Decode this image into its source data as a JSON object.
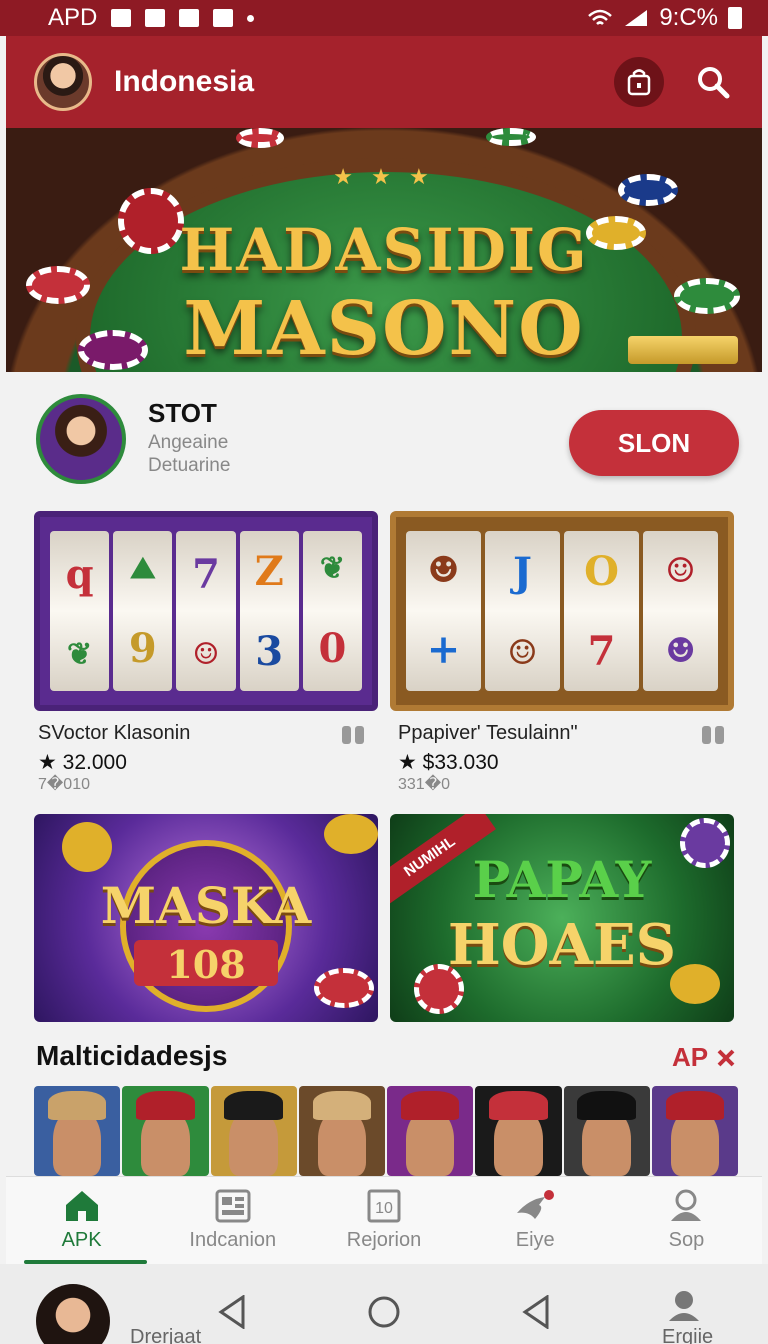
{
  "status_bar": {
    "left_text": "APD",
    "right_text": "9:C%"
  },
  "app_bar": {
    "title": "Indonesia",
    "icons": [
      "profile-avatar",
      "bag-icon",
      "search-icon"
    ]
  },
  "hero": {
    "line1": "HADASIDIG",
    "line2": "MASONO",
    "stars": "★ ★ ★"
  },
  "featured": {
    "name": "STOT",
    "subtitle1": "Angeaine",
    "subtitle2": "Detuarine",
    "button_label": "SLON"
  },
  "slot_cards": [
    {
      "title": "SVoctor Klasonin",
      "price": "32.000",
      "meta": "7�010",
      "reels": [
        "q",
        "7",
        "Z",
        "9",
        "3"
      ]
    },
    {
      "title": "Ppapiver' Tesulainn\"",
      "price": "$33.030",
      "meta": "331�0",
      "reels": [
        "J",
        "O",
        "7"
      ]
    }
  ],
  "promo_cards": [
    {
      "line1": "MASKA",
      "line2": "108"
    },
    {
      "ribbon": "NUMIHL",
      "line1": "PAPAY",
      "line2": "HOAES"
    }
  ],
  "section": {
    "title": "Malticidadesjs",
    "link_label": "AP"
  },
  "bottom_nav": [
    {
      "label": "APK",
      "icon": "home-icon",
      "active": true
    },
    {
      "label": "Indcanion",
      "icon": "grid-icon",
      "active": false
    },
    {
      "label": "Rejorion",
      "icon": "calendar-icon",
      "active": false
    },
    {
      "label": "Eiye",
      "icon": "bird-icon",
      "active": false
    },
    {
      "label": "Sop",
      "icon": "person-icon",
      "active": false
    }
  ],
  "system_nav": {
    "left_label": "Drerjaat",
    "right_label": "Ergiie"
  },
  "colors": {
    "brand_red": "#a5222c",
    "accent_green": "#1f7a3a",
    "button_red": "#c4303a"
  }
}
